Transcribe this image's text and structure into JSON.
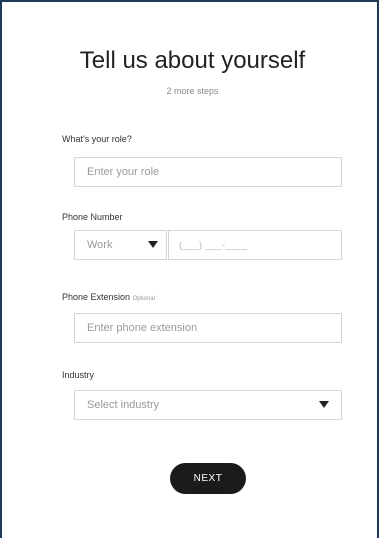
{
  "header": {
    "title": "Tell us about yourself",
    "subtitle": "2 more steps"
  },
  "form": {
    "role": {
      "label": "What's your role?",
      "placeholder": "Enter your role"
    },
    "phone": {
      "label": "Phone Number",
      "type_selected": "Work",
      "number_placeholder": "(___) ___-____"
    },
    "extension": {
      "label": "Phone Extension",
      "optional_tag": "Optional",
      "placeholder": "Enter phone extension"
    },
    "industry": {
      "label": "Industry",
      "selected": "Select industry"
    }
  },
  "actions": {
    "next_label": "NEXT"
  },
  "icons": {
    "dropdown": "caret-down-icon"
  }
}
